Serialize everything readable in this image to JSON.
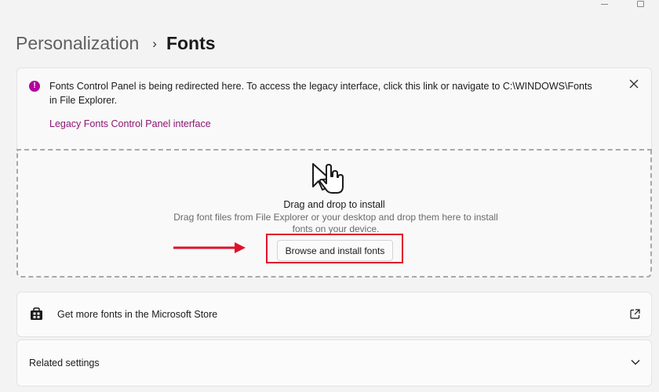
{
  "window_controls": {
    "minimize_icon": "minimize-icon",
    "maximize_icon": "maximize-icon"
  },
  "breadcrumb": {
    "parent": "Personalization",
    "separator": "›",
    "current": "Fonts"
  },
  "info_bar": {
    "icon": "info-icon",
    "icon_glyph": "!",
    "message": "Fonts Control Panel is being redirected here. To access the legacy interface, click this link or navigate to C:\\WINDOWS\\Fonts in File Explorer.",
    "link": "Legacy Fonts Control Panel interface",
    "close_icon": "close-icon"
  },
  "dropzone": {
    "icon": "hand-pointer-icon",
    "title": "Drag and drop to install",
    "description": "Drag font files from File Explorer or your desktop and drop them here to install fonts on your device.",
    "browse_button": "Browse and install fonts"
  },
  "annotation": {
    "arrow_color": "#e0112b",
    "box_color": "#e0112b"
  },
  "store": {
    "icon": "store-icon",
    "label": "Get more fonts in the Microsoft Store",
    "action_icon": "external-link-icon"
  },
  "related_settings": {
    "label": "Related settings",
    "action_icon": "chevron-down-icon"
  },
  "colors": {
    "accent": "#b4009e",
    "link": "#8b1672",
    "annotation": "#e0112b"
  }
}
